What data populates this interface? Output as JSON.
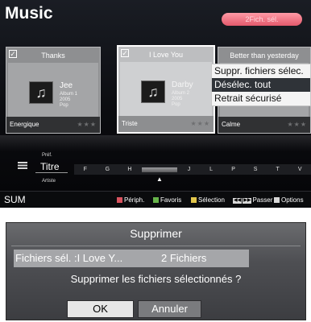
{
  "header": {
    "title": "Music",
    "selected_badge": "2Fich. sél."
  },
  "cards": [
    {
      "title": "Thanks",
      "checked": true,
      "artist": "Jee",
      "album": "Album 1",
      "year": "2005",
      "genre": "Pop",
      "mood": "Energique",
      "rating": "★★★",
      "icon": "music-note-icon"
    },
    {
      "title": "I Love You",
      "checked": true,
      "artist": "Darby",
      "album": "Album 2",
      "year": "2005",
      "genre": "Pop",
      "mood": "Triste",
      "rating": "★★★",
      "icon": "music-note-icon"
    },
    {
      "title": "Better than yesterday",
      "mood": "Calme",
      "rating": "★★★"
    }
  ],
  "context_menu": {
    "items": [
      "Suppr. fichiers sélec.",
      "Désélec. tout",
      "Retrait sécurisé"
    ],
    "active_index": 1
  },
  "sort": {
    "previous": "Préf.",
    "current": "Titre",
    "next": "Artiste"
  },
  "alphabet": [
    "F",
    "G",
    "H",
    "",
    "J",
    "L",
    "P",
    "S",
    "T",
    "V"
  ],
  "bottom_bar": {
    "device": "SUM",
    "hints": [
      "Périph.",
      "Favoris",
      "Sélection",
      "Passer",
      "Options"
    ],
    "hint_colors": [
      "#d9535f",
      "#66b34a",
      "#e2c64b",
      "#5d8fd4"
    ]
  },
  "dialog": {
    "title": "Supprimer",
    "files_label": "Fichiers sél. :I Love Y...",
    "files_count": "2 Fichiers",
    "message": "Supprimer les fichiers sélectionnés ?",
    "ok_label": "OK",
    "cancel_label": "Annuler"
  }
}
